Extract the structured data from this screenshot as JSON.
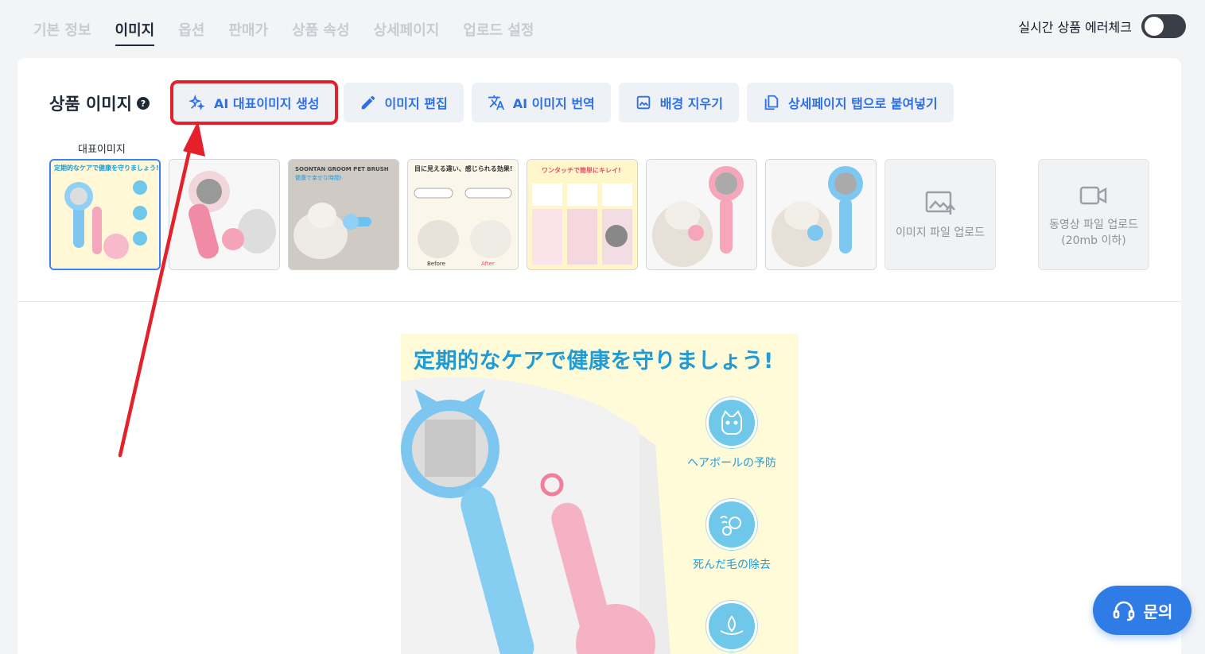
{
  "tabs": [
    {
      "label": "기본 정보",
      "active": false
    },
    {
      "label": "이미지",
      "active": true
    },
    {
      "label": "옵션",
      "active": false
    },
    {
      "label": "판매가",
      "active": false
    },
    {
      "label": "상품 속성",
      "active": false
    },
    {
      "label": "상세페이지",
      "active": false
    },
    {
      "label": "업로드 설정",
      "active": false
    }
  ],
  "realtime_check": {
    "label": "실시간 상품 에러체크",
    "enabled": false
  },
  "section": {
    "title": "상품 이미지",
    "help": "?"
  },
  "toolbar": {
    "ai_main_image": "AI 대표이미지 생성",
    "edit_image": "이미지 편집",
    "ai_translate": "AI 이미지 번역",
    "remove_bg": "배경 지우기",
    "paste_detail": "상세페이지 탭으로 붙여넣기"
  },
  "rep_label": "대표이미지",
  "thumb_texts": {
    "t1": "定期的なケアで健康を守りましょう!",
    "t3": "SOONTAN GROOM PET BRUSH",
    "t3b": "健康で幸せな時間!",
    "t4": "目に見える違い、感じられる効果!",
    "t4a": "Before",
    "t4b": "After",
    "t5": "ワンタッチで簡単にキレイ!"
  },
  "upload_image": "이미지 파일 업로드",
  "upload_video": "동영상 파일 업로드\n(20mb 이하)",
  "preview": {
    "title": "定期的なケアで健康を守りましょう!",
    "features": [
      "ヘアボールの予防",
      "死んだ毛の除去"
    ]
  },
  "chat_button": "문의",
  "colors": {
    "accent": "#2f6fe4",
    "highlight": "#e4202b",
    "toggle_off": "#3a3f47"
  }
}
